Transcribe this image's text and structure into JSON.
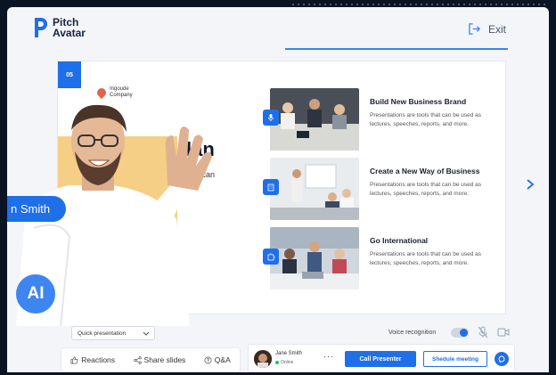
{
  "app": {
    "brand_line1": "Pitch",
    "brand_line2": "Avatar",
    "exit_label": "Exit"
  },
  "slide": {
    "number": "05",
    "company_name": "Ingoude Company",
    "heading_fragment": "lan",
    "sub_fragment": "that can",
    "small_fragment": "e\nhe,",
    "features": [
      {
        "icon": "microphone-icon",
        "title": "Build New Business Brand",
        "desc": "Presentations are tools that can be used as lectures, speeches, reports, and more."
      },
      {
        "icon": "building-icon",
        "title": "Create a New Way of Business",
        "desc": "Presentations are tools that can be used as lectures, speeches, reports, and more."
      },
      {
        "icon": "puzzle-icon",
        "title": "Go International",
        "desc": "Presentations are tools that can be used as lectures, speeches, reports, and more."
      }
    ]
  },
  "avatar": {
    "name_pill": "n Smith",
    "ai_badge": "AI"
  },
  "controls": {
    "quick_presentation": "Quick presentation",
    "voice_recognition": "Voice recognition"
  },
  "toolbar": {
    "reactions": "Reactions",
    "share_slides": "Share slides",
    "qa": "Q&A"
  },
  "presenter": {
    "name": "Jane Smith",
    "status": "Online",
    "more": "···",
    "call_label": "Call Presenter",
    "schedule_label": "Shedule meeting"
  },
  "colors": {
    "accent": "#1f6fe8",
    "background": "#0b1424",
    "yellow_panel": "#f6cf86"
  }
}
